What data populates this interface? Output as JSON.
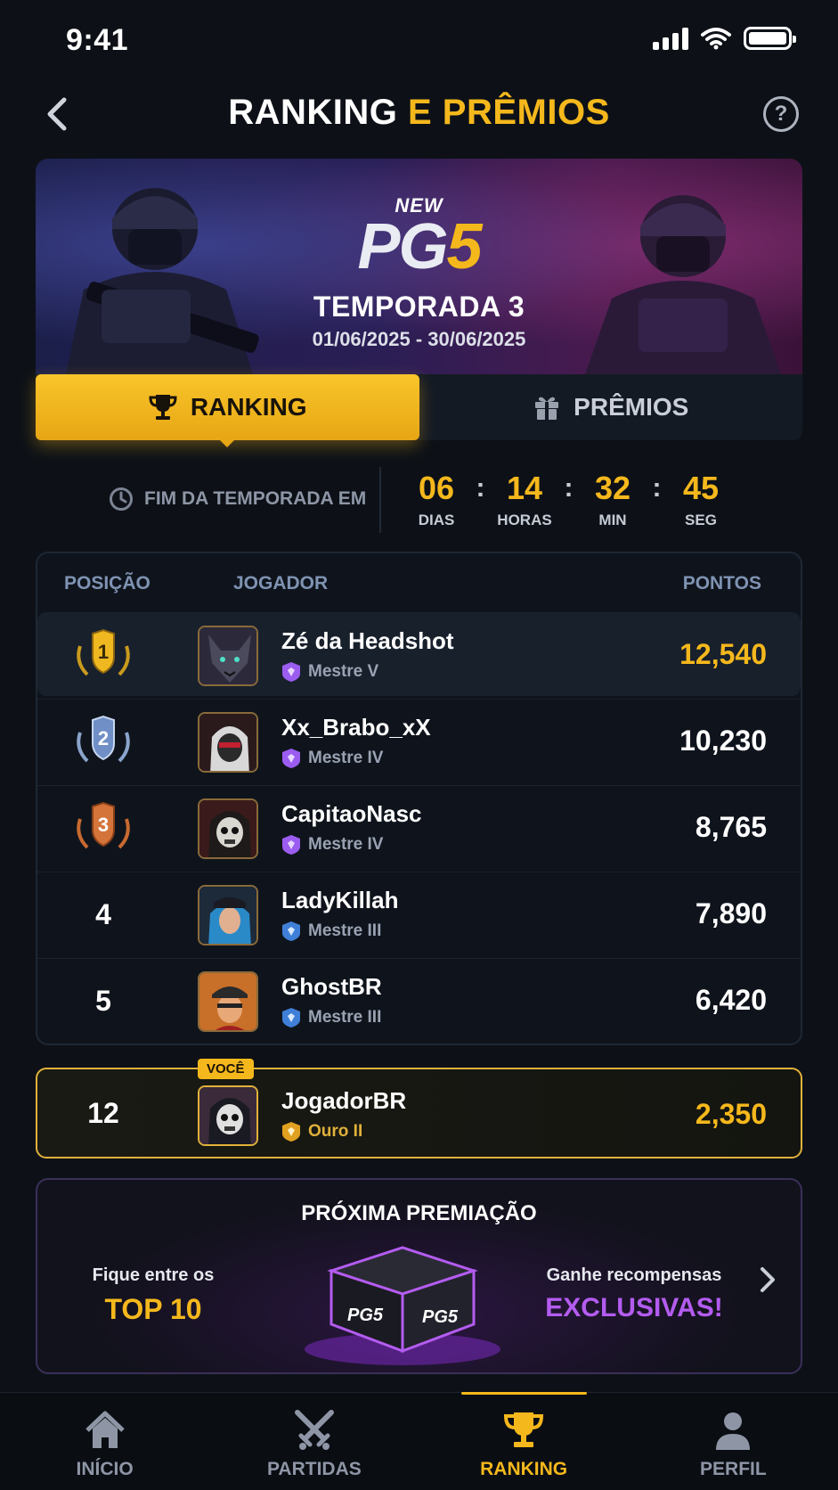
{
  "status_bar": {
    "time": "9:41"
  },
  "header": {
    "title_white": "RANKING",
    "title_accent": "E PRÊMIOS",
    "help_label": "?"
  },
  "banner": {
    "logo_new": "NEW",
    "logo_pg": "PG",
    "logo_five": "5",
    "season": "TEMPORADA 3",
    "dates": "01/06/2025 - 30/06/2025"
  },
  "tabs": [
    {
      "label": "RANKING",
      "active": true,
      "icon": "trophy-icon"
    },
    {
      "label": "PRÊMIOS",
      "active": false,
      "icon": "gift-icon"
    }
  ],
  "countdown": {
    "label": "FIM DA TEMPORADA EM",
    "units": [
      {
        "value": "06",
        "caption": "DIAS"
      },
      {
        "value": "14",
        "caption": "HORAS"
      },
      {
        "value": "32",
        "caption": "MIN"
      },
      {
        "value": "45",
        "caption": "SEG"
      }
    ],
    "separator": ":"
  },
  "table": {
    "headers": {
      "position": "POSIÇÃO",
      "player": "JOGADOR",
      "points": "PONTOS"
    },
    "rows": [
      {
        "position": "1",
        "name": "Zé da Headshot",
        "rank": "Mestre V",
        "points": "12,540",
        "medal": "gold"
      },
      {
        "position": "2",
        "name": "Xx_Brabo_xX",
        "rank": "Mestre IV",
        "points": "10,230",
        "medal": "silver"
      },
      {
        "position": "3",
        "name": "CapitaoNasc",
        "rank": "Mestre IV",
        "points": "8,765",
        "medal": "bronze"
      },
      {
        "position": "4",
        "name": "LadyKillah",
        "rank": "Mestre III",
        "points": "7,890",
        "medal": ""
      },
      {
        "position": "5",
        "name": "GhostBR",
        "rank": "Mestre III",
        "points": "6,420",
        "medal": ""
      }
    ]
  },
  "you": {
    "badge": "VOCÊ",
    "position": "12",
    "name": "JogadorBR",
    "rank": "Ouro II",
    "points": "2,350"
  },
  "prize": {
    "title": "PRÓXIMA PREMIAÇÃO",
    "left_small": "Fique entre os",
    "left_big": "TOP 10",
    "right_small": "Ganhe recompensas",
    "right_big": "EXCLUSIVAS!",
    "chest_logo": "PG5"
  },
  "nav": [
    {
      "label": "INÍCIO",
      "icon": "home-icon",
      "active": false
    },
    {
      "label": "PARTIDAS",
      "icon": "crossed-swords-icon",
      "active": false
    },
    {
      "label": "RANKING",
      "icon": "trophy-icon",
      "active": true
    },
    {
      "label": "PERFIL",
      "icon": "person-icon",
      "active": false
    }
  ],
  "colors": {
    "accent": "#f5b81c",
    "background": "#0d1117",
    "purple": "#b45cf0",
    "master_rank": "#9b5cf0",
    "diamond_rank": "#3f7fd8",
    "gold_rank": "#e0a020"
  }
}
